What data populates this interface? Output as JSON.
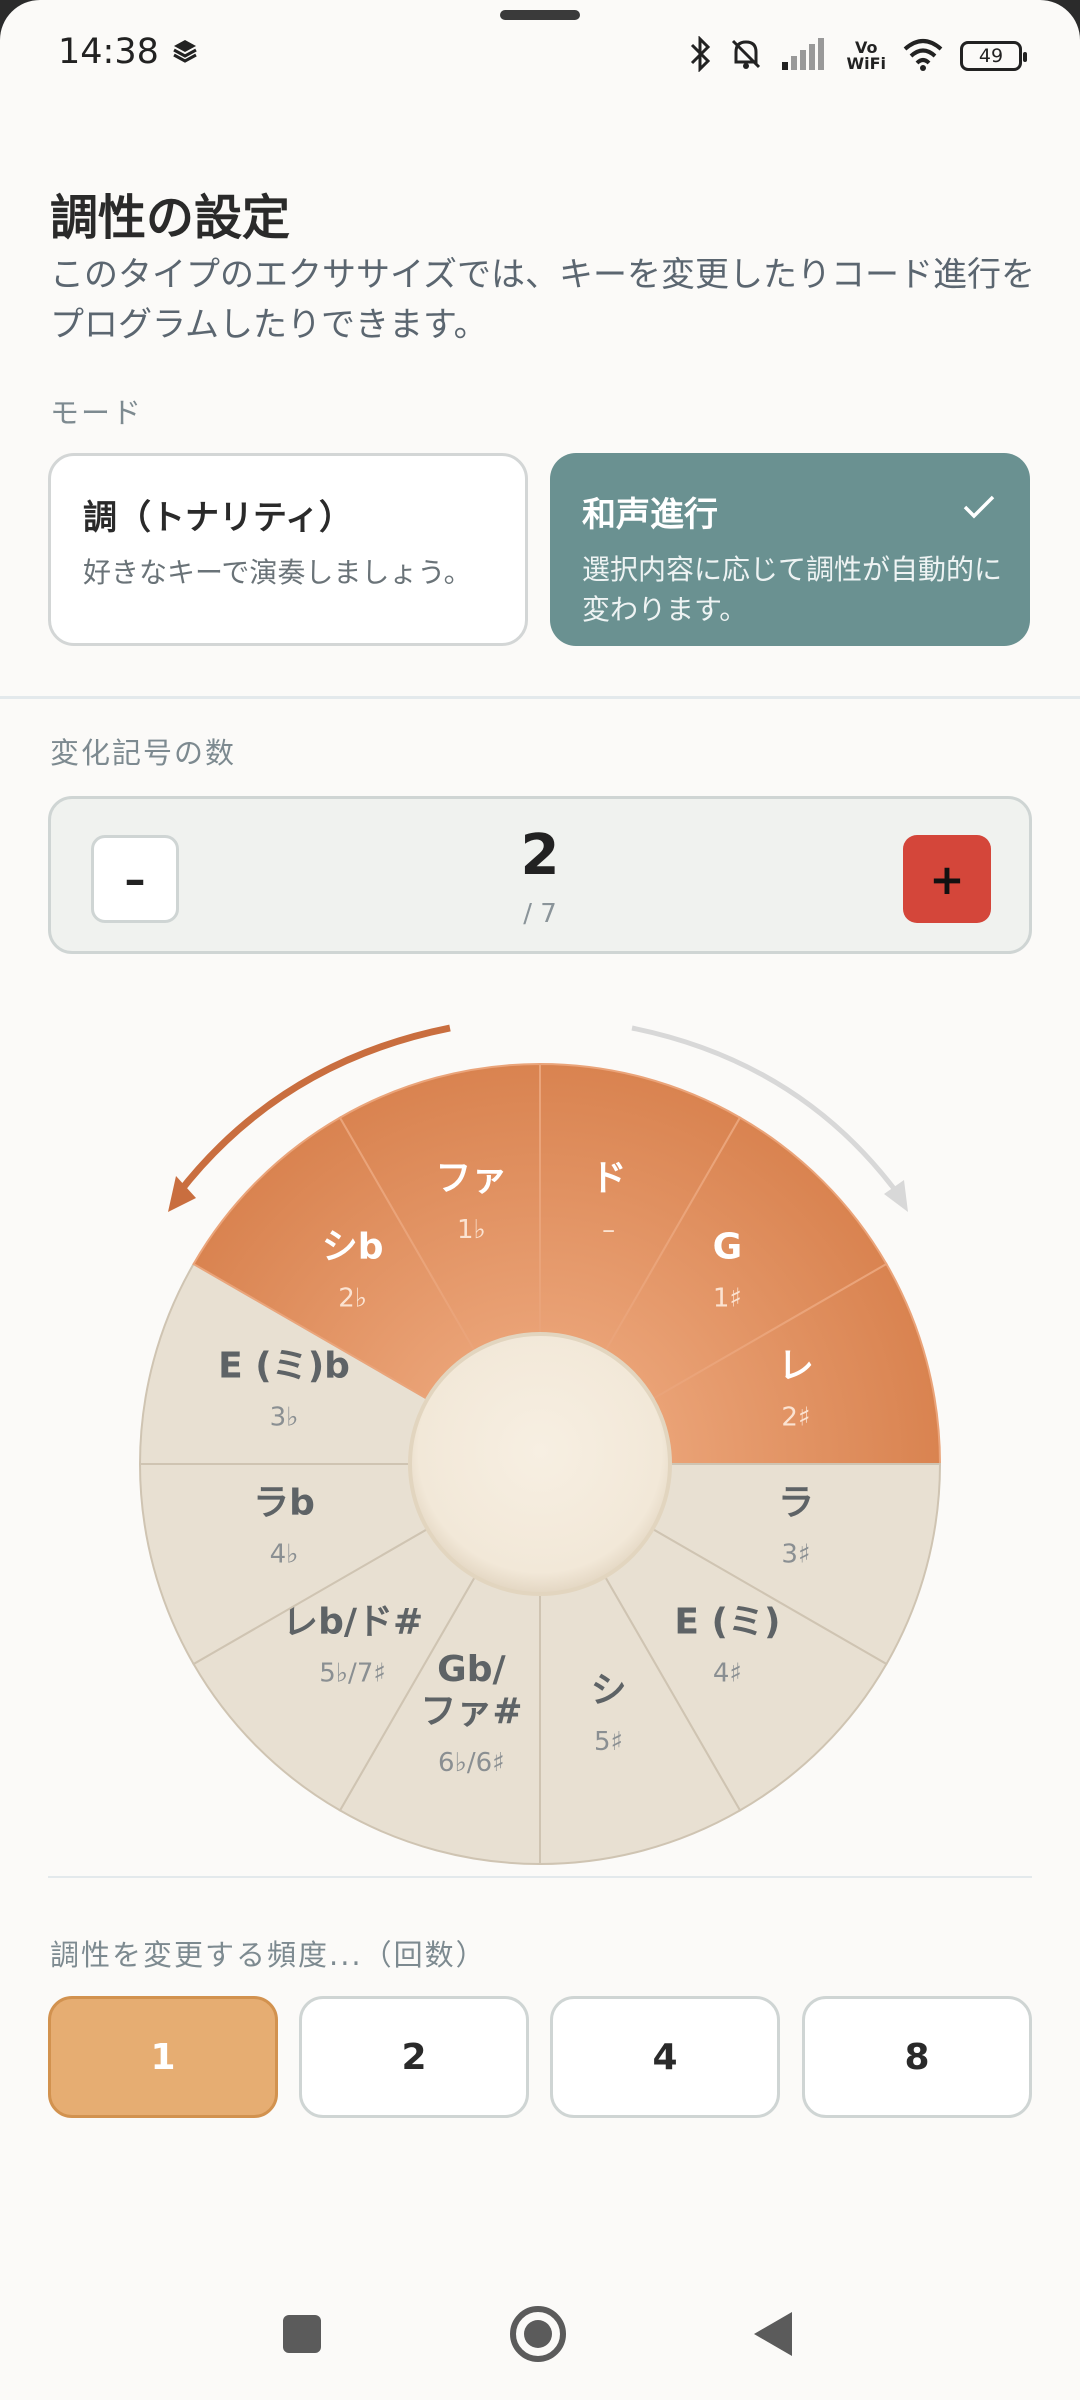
{
  "status": {
    "time": "14:38",
    "battery": "49",
    "vowifi_top": "Vo",
    "vowifi_bottom": "WiFi"
  },
  "header": {
    "title": "調性の設定",
    "subtitle": "このタイプのエクササイズでは、キーを変更したりコード進行をプログラムしたりできます。"
  },
  "mode": {
    "label": "モード",
    "options": [
      {
        "title": "調（トナリティ）",
        "desc": "好きなキーで演奏しましょう。",
        "selected": false
      },
      {
        "title": "和声進行",
        "desc": "選択内容に応じて調性が自動的に変わります。",
        "selected": true
      }
    ]
  },
  "accidentals": {
    "label": "変化記号の数",
    "value": "2",
    "max": "/ 7",
    "minus": "–",
    "plus": "+"
  },
  "wheel": {
    "segments": [
      {
        "name": "ド",
        "sig": "–",
        "active": true
      },
      {
        "name": "G",
        "sig": "1♯",
        "active": true
      },
      {
        "name": "レ",
        "sig": "2♯",
        "active": true
      },
      {
        "name": "ラ",
        "sig": "3♯",
        "active": false
      },
      {
        "name": "E (ミ)",
        "sig": "4♯",
        "active": false
      },
      {
        "name": "シ",
        "sig": "5♯",
        "active": false
      },
      {
        "name": "Gb/ファ#",
        "sig": "6♭/6♯",
        "active": false
      },
      {
        "name": "レb/ド#",
        "sig": "5♭/7♯",
        "active": false
      },
      {
        "name": "ラb",
        "sig": "4♭",
        "active": false
      },
      {
        "name": "E (ミ)b",
        "sig": "3♭",
        "active": false
      },
      {
        "name": "シb",
        "sig": "2♭",
        "active": true
      },
      {
        "name": "ファ",
        "sig": "1♭",
        "active": true
      }
    ]
  },
  "frequency": {
    "label": "調性を変更する頻度...（回数）",
    "options": [
      "1",
      "2",
      "4",
      "8"
    ],
    "selected": "1"
  },
  "colors": {
    "accent_teal": "#6a9191",
    "accent_red": "#d4463a",
    "active_orange": "#df8a58",
    "inactive_beige": "#e8e0d2",
    "selected_freq": "#e6ad72"
  }
}
